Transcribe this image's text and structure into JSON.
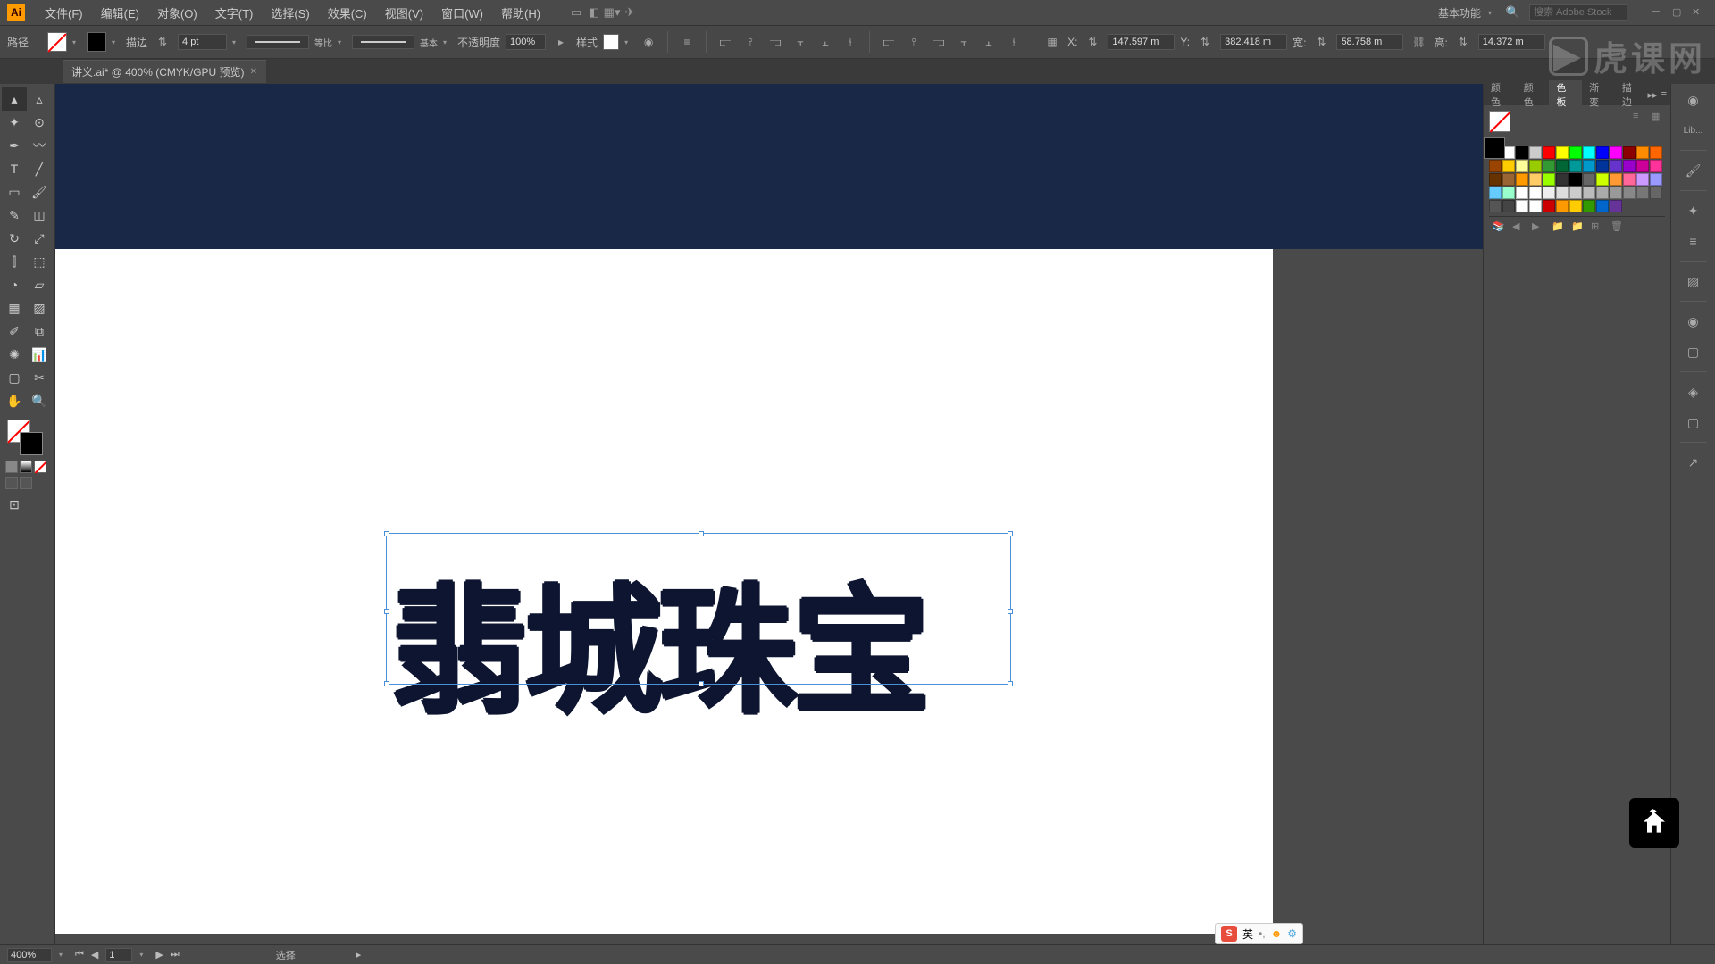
{
  "app": {
    "name": "Ai"
  },
  "menubar": {
    "items": [
      "文件(F)",
      "编辑(E)",
      "对象(O)",
      "文字(T)",
      "选择(S)",
      "效果(C)",
      "视图(V)",
      "窗口(W)",
      "帮助(H)"
    ],
    "workspace": "基本功能",
    "search_placeholder": "搜索 Adobe Stock"
  },
  "controlbar": {
    "label_mode": "路径",
    "stroke_label": "描边",
    "stroke_weight": "4 pt",
    "profile_label": "等比",
    "brush_label": "基本",
    "opacity_label": "不透明度",
    "opacity_value": "100%",
    "style_label": "样式",
    "x_label": "X:",
    "x_value": "147.597 m",
    "y_label": "Y:",
    "y_value": "382.418 m",
    "w_label": "宽:",
    "w_value": "58.758 m",
    "h_label": "高:",
    "h_value": "14.372 m"
  },
  "tab": {
    "title": "讲义.ai* @ 400% (CMYK/GPU 预览)"
  },
  "artwork": {
    "text": "翡城珠宝"
  },
  "panels": {
    "tabs": [
      "颜色",
      "颜色",
      "色板",
      "渐变",
      "描边"
    ],
    "active_tab": "色板",
    "lib_label": "Lib..."
  },
  "swatches": [
    "#ffffff",
    "#ffffff",
    "#000000",
    "#cccccc",
    "#ff0000",
    "#ffff00",
    "#00ff00",
    "#00ffff",
    "#0000ff",
    "#ff00ff",
    "#8b0000",
    "#ff8c00",
    "#ff6600",
    "#994400",
    "#ffcc00",
    "#ffff99",
    "#99cc00",
    "#339933",
    "#006633",
    "#009999",
    "#0099cc",
    "#003399",
    "#6633cc",
    "#9900cc",
    "#cc0099",
    "#ff3399",
    "#663300",
    "#996633",
    "#ff9900",
    "#ffcc66",
    "#99ff00",
    "#333333",
    "#000000",
    "#666666",
    "#ccff00",
    "#ff9933",
    "#ff6699",
    "#cc99ff",
    "#9999ff",
    "#66ccff",
    "#99ffcc",
    "#ffffff",
    "#ffffff",
    "#eeeeee",
    "#dddddd",
    "#cccccc",
    "#bbbbbb",
    "#aaaaaa",
    "#999999",
    "#888888",
    "#777777",
    "#666666",
    "#555555",
    "#444444",
    "#ffffff",
    "#ffffff",
    "#cc0000",
    "#ff9900",
    "#ffcc00",
    "#339900",
    "#0066cc",
    "#663399"
  ],
  "statusbar": {
    "zoom": "400%",
    "page": "1",
    "tool": "选择"
  },
  "watermark": {
    "text": "虎课网"
  },
  "ime": {
    "lang": "英"
  }
}
